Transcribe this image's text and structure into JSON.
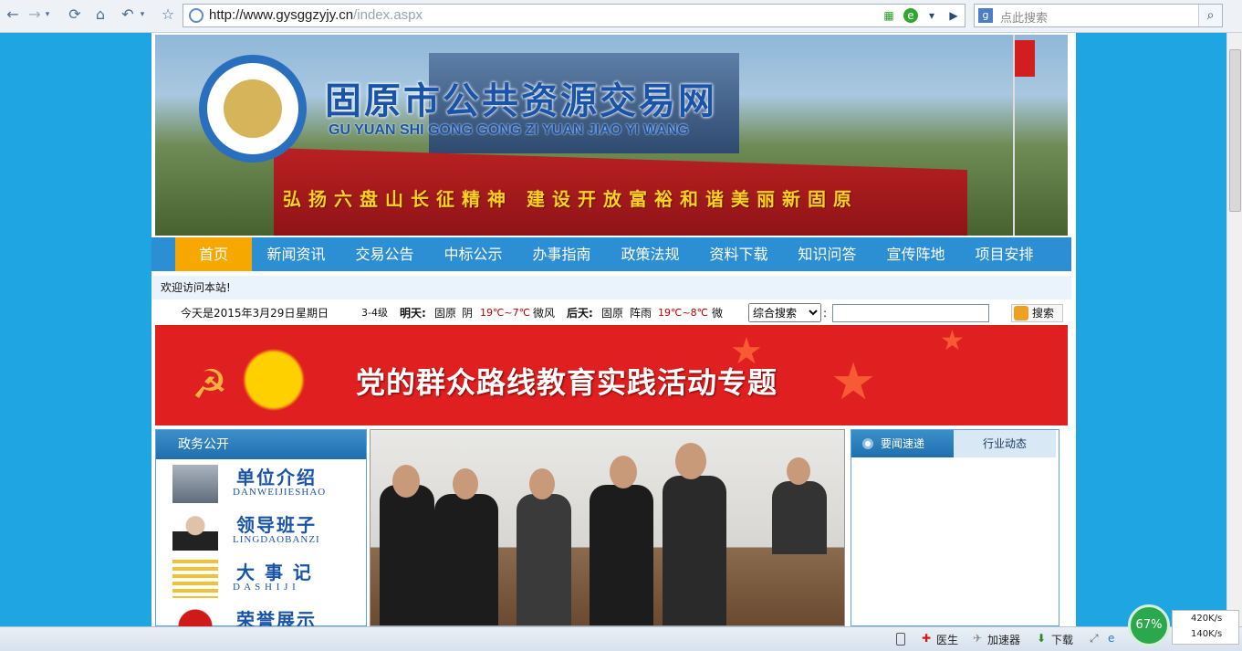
{
  "browser": {
    "url_host": "http://www.gysggzyjy.cn",
    "url_path": "/index.aspx",
    "search_placeholder": "点此搜索"
  },
  "banner": {
    "title": "固原市公共资源交易网",
    "subtitle": "GU YUAN SHI GONG GONG ZI YUAN JIAO YI WANG",
    "slogan": "弘扬六盘山长征精神 建设开放富裕和谐美丽新固原"
  },
  "nav": {
    "items": [
      "首页",
      "新闻资讯",
      "交易公告",
      "中标公示",
      "办事指南",
      "政策法规",
      "资料下载",
      "知识问答",
      "宣传阵地",
      "项目安排"
    ]
  },
  "welcome": "欢迎访问本站!",
  "info": {
    "date": "今天是2015年3月29日",
    "weekday": "星期日",
    "wind_level": "3-4级",
    "tomorrow_label": "明天:",
    "tomorrow_city": "固原",
    "tomorrow_weather": "阴",
    "tomorrow_temp": "19℃~7℃",
    "tomorrow_wind": "微风",
    "after_label": "后天:",
    "after_city": "固原",
    "after_weather": "阵雨",
    "after_temp": "19℃~8℃",
    "after_wind": "微",
    "search_type": "综合搜索",
    "search_button": "搜索"
  },
  "promo": {
    "text": "党的群众路线教育实践活动专题"
  },
  "left_panel": {
    "title": "政务公开",
    "items": [
      {
        "cn": "单位介绍",
        "py": "DANWEIJIESHAO"
      },
      {
        "cn": "领导班子",
        "py": "LINGDAOBANZI"
      },
      {
        "cn": "大 事 记",
        "py": "D A S H I J I"
      },
      {
        "cn": "荣誉展示",
        "py": ""
      }
    ]
  },
  "right_panel": {
    "tab_active": "要闻速递",
    "tab_other": "行业动态"
  },
  "statusbar": {
    "doctor": "医生",
    "accelerator": "加速器",
    "download": "下载",
    "percent": "67%",
    "up_speed": "420K/s",
    "down_speed": "140K/s"
  },
  "colors": {
    "nav_blue": "#2d8fd3",
    "nav_active": "#f7a800",
    "title_blue": "#1a54a8",
    "page_bg": "#1fa5e1"
  }
}
